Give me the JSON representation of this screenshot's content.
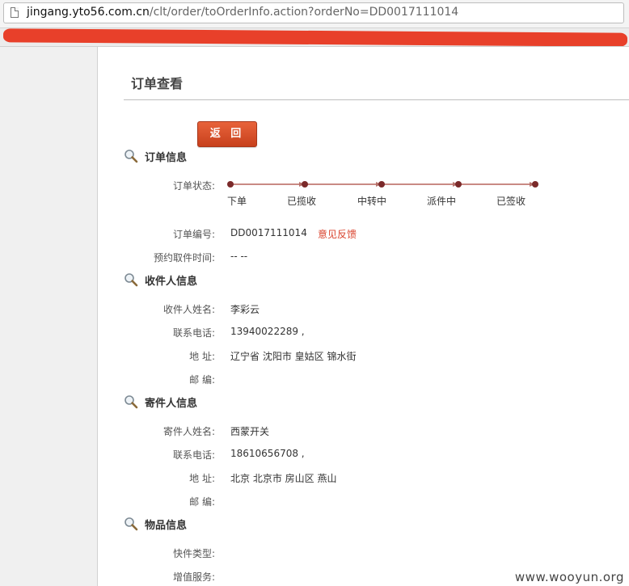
{
  "browser": {
    "url_host": "jingang.yto56.com.cn",
    "url_path": "/clt/order/toOrderInfo.action?orderNo=DD0017111014"
  },
  "page": {
    "title": "订单查看",
    "back_label": "返 回"
  },
  "order_info": {
    "heading": "订单信息",
    "status_label": "订单状态:",
    "steps": [
      "下单",
      "已揽收",
      "中转中",
      "派件中",
      "已签收"
    ],
    "order_no_label": "订单编号:",
    "order_no": "DD0017111014",
    "feedback_link": "意见反馈",
    "pickup_time_label": "预约取件时间:",
    "pickup_time": "-- --"
  },
  "receiver": {
    "heading": "收件人信息",
    "name_label": "收件人姓名:",
    "name": "李彩云",
    "phone_label": "联系电话:",
    "phone": "13940022289 ,",
    "address_label": "地 址:",
    "address": "辽宁省 沈阳市 皇姑区 锦水街",
    "zip_label": "邮 编:",
    "zip": ""
  },
  "sender": {
    "heading": "寄件人信息",
    "name_label": "寄件人姓名:",
    "name": "西蒙开关",
    "phone_label": "联系电话:",
    "phone": "18610656708 ,",
    "address_label": "地 址:",
    "address": "北京 北京市 房山区 燕山",
    "zip_label": "邮 编:",
    "zip": ""
  },
  "goods": {
    "heading": "物品信息",
    "type_label": "快件类型:",
    "type": "",
    "service_label": "增值服务:",
    "service": ""
  },
  "watermark": "www.wooyun.org",
  "colors": {
    "accent_button": "#d4502b",
    "progress_dot": "#7b2a2a",
    "progress_line": "#c98a84",
    "link": "#d9422c"
  }
}
